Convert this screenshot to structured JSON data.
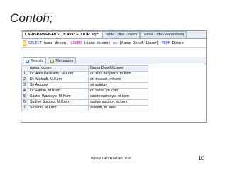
{
  "slide": {
    "title": "Contoh;",
    "footer_url": "www.rahmadani.net",
    "page_number": "10"
  },
  "ssms": {
    "tabs": [
      {
        "label": "LARISPAWEB-PC\\....n akar FLOOR.sql*",
        "active": true
      },
      {
        "label": "Table - dbo.Dosen",
        "active": false
      },
      {
        "label": "Table - dbo.Mahasiswa",
        "active": false
      }
    ],
    "query": {
      "kw_select": "SELECT",
      "col": " nama_dosen, ",
      "fn_lower": "LOWER",
      "args": " (nama_dosen) ",
      "kw_as": "as",
      "alias": " [Nama DoseN Lower] ",
      "kw_from": "FROM",
      "table": " Dosen"
    },
    "result_tabs": [
      {
        "label": "Results",
        "icon": "grid-icon",
        "active": true
      },
      {
        "label": "Messages",
        "icon": "messages-icon",
        "active": false
      }
    ],
    "grid": {
      "columns": [
        "nama_dosen",
        "Nama DoseN Lower"
      ],
      "rows": [
        {
          "num": "1",
          "nama_dosen": "Dr. Alex Del Piero, M.Kom",
          "lower": "dr. alex del piero, m.kom"
        },
        {
          "num": "2",
          "nama_dosen": "Dr. Mukadi, M.Kom",
          "lower": "dr. mukadi, m.kom"
        },
        {
          "num": "3",
          "nama_dosen": "Sir Astutay",
          "lower": "sir astutay"
        },
        {
          "num": "4",
          "nama_dosen": "Dr. Fathin, M.Kom",
          "lower": "dr. fathin, m.kom"
        },
        {
          "num": "5",
          "nama_dosen": "Sastro Wardoyo, M.Kom",
          "lower": "sastro wardoyo, m.kom"
        },
        {
          "num": "6",
          "nama_dosen": "Sudiyo Sucipto, M.Kom",
          "lower": "sudiyo sucipto, m.kom"
        },
        {
          "num": "7",
          "nama_dosen": "Susanti, M.Kom",
          "lower": "susanti, m.kom"
        }
      ]
    }
  }
}
